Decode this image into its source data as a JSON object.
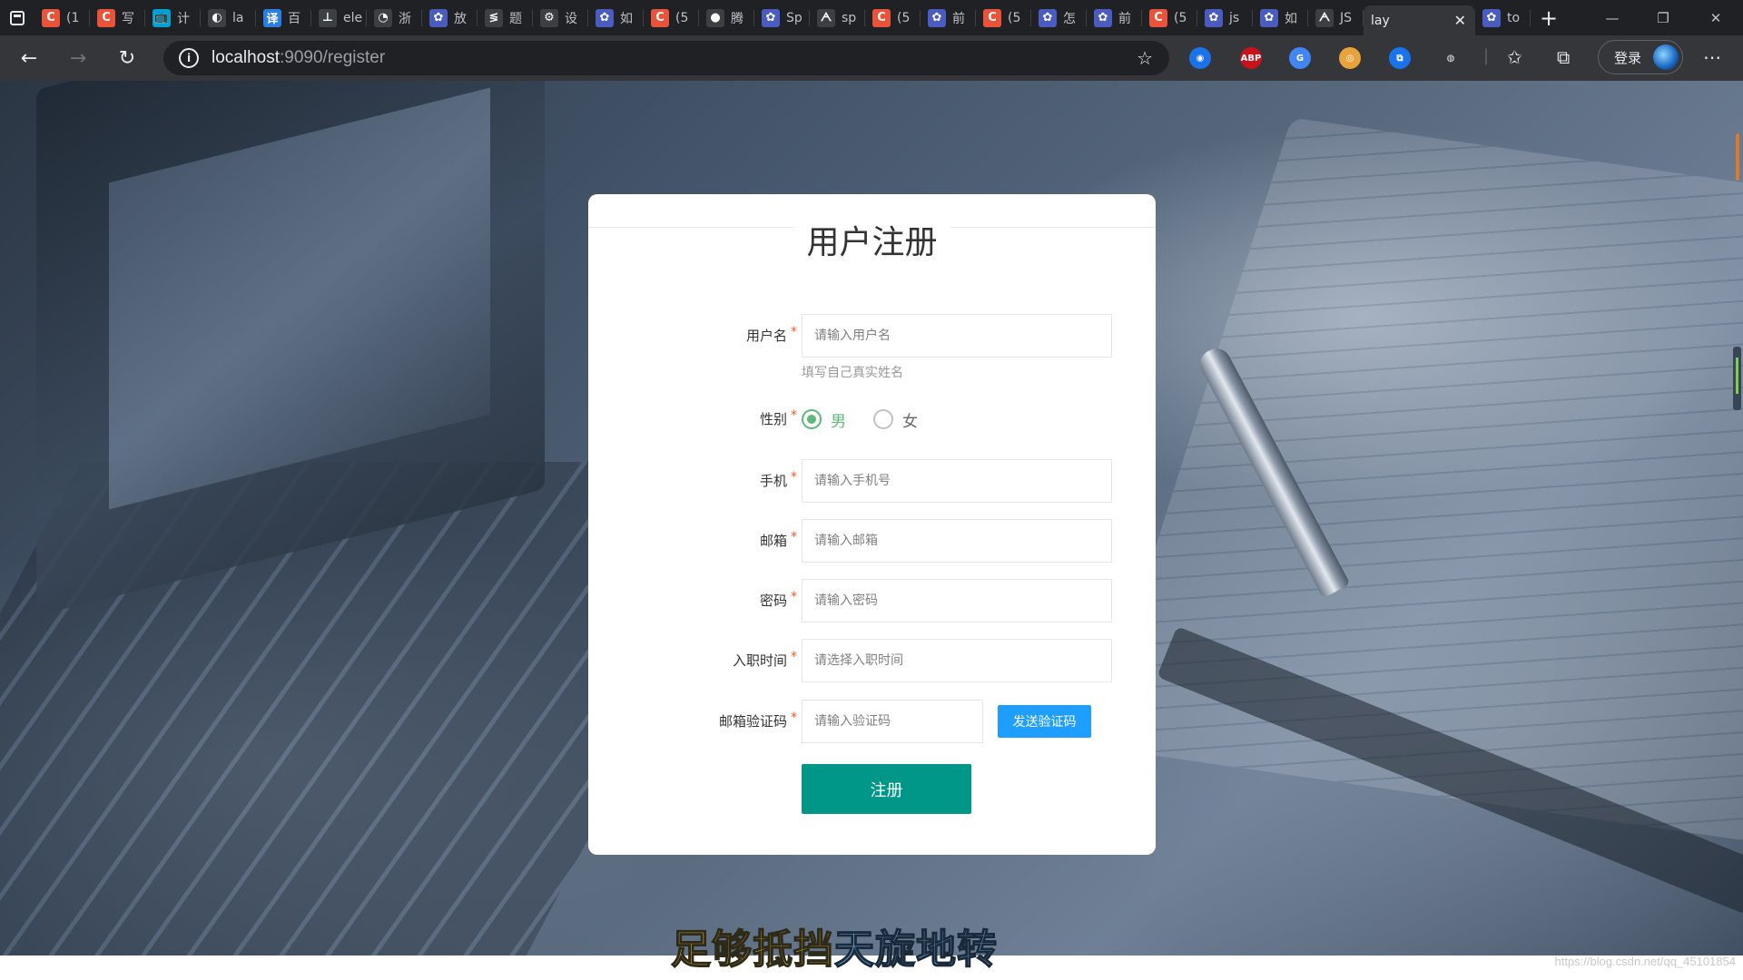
{
  "browser": {
    "tabs": [
      {
        "label": "(1",
        "icon": "csdn-icon",
        "color": "#e9533a",
        "glyph": "C"
      },
      {
        "label": "写",
        "icon": "csdn-icon",
        "color": "#e9533a",
        "glyph": "C"
      },
      {
        "label": "计",
        "icon": "bilibili-icon",
        "color": "#00a1d6",
        "glyph": "📺"
      },
      {
        "label": "la",
        "icon": "layui-icon",
        "color": "#3c4043",
        "glyph": "◐"
      },
      {
        "label": "百",
        "icon": "translate-icon",
        "color": "#2a7de1",
        "glyph": "译"
      },
      {
        "label": "ele",
        "icon": "element-icon",
        "color": "#3c4043",
        "glyph": "⊥"
      },
      {
        "label": "浙",
        "icon": "edu-icon",
        "color": "#3c4043",
        "glyph": "◔"
      },
      {
        "label": "放",
        "icon": "baidu-icon",
        "color": "#4a5cbf",
        "glyph": "✿"
      },
      {
        "label": "题",
        "icon": "leetcode-icon",
        "color": "#3c4043",
        "glyph": "≶"
      },
      {
        "label": "设",
        "icon": "gear-icon",
        "color": "#3c4043",
        "glyph": "⚙"
      },
      {
        "label": "如",
        "icon": "baidu-icon",
        "color": "#4a5cbf",
        "glyph": "✿"
      },
      {
        "label": "(5",
        "icon": "csdn-icon",
        "color": "#e9533a",
        "glyph": "C"
      },
      {
        "label": "腾",
        "icon": "tencent-icon",
        "color": "#3c4043",
        "glyph": "●"
      },
      {
        "label": "Sp",
        "icon": "baidu-icon",
        "color": "#4a5cbf",
        "glyph": "✿"
      },
      {
        "label": "sp",
        "icon": "spring-icon",
        "color": "#3c4043",
        "glyph": "ᗅ"
      },
      {
        "label": "(5",
        "icon": "csdn-icon",
        "color": "#e9533a",
        "glyph": "C"
      },
      {
        "label": "前",
        "icon": "baidu-icon",
        "color": "#4a5cbf",
        "glyph": "✿"
      },
      {
        "label": "(5",
        "icon": "csdn-icon",
        "color": "#e9533a",
        "glyph": "C"
      },
      {
        "label": "怎",
        "icon": "baidu-icon",
        "color": "#4a5cbf",
        "glyph": "✿"
      },
      {
        "label": "前",
        "icon": "baidu-icon",
        "color": "#4a5cbf",
        "glyph": "✿"
      },
      {
        "label": "(5",
        "icon": "csdn-icon",
        "color": "#e9533a",
        "glyph": "C"
      },
      {
        "label": "js",
        "icon": "baidu-icon",
        "color": "#4a5cbf",
        "glyph": "✿"
      },
      {
        "label": "如",
        "icon": "baidu-icon",
        "color": "#4a5cbf",
        "glyph": "✿"
      },
      {
        "label": "JS",
        "icon": "spring-icon",
        "color": "#3c4043",
        "glyph": "ᗅ"
      }
    ],
    "active_tab": {
      "label": "lay",
      "close": "✕"
    },
    "last_tab": {
      "label": "to",
      "icon": "baidu-icon",
      "color": "#4a5cbf",
      "glyph": "✿"
    },
    "new_tab": "+",
    "url_host": "localhost",
    "url_path": ":9090/register",
    "login_label": "登录",
    "extensions": [
      {
        "name": "edge-collections-icon",
        "color": "#1a73e8",
        "glyph": "◉"
      },
      {
        "name": "adblock-plus-icon",
        "color": "#c7131b",
        "glyph": "ABP"
      },
      {
        "name": "google-translate-icon",
        "color": "#4285f4",
        "glyph": "G"
      },
      {
        "name": "chrome-icon",
        "color": "#e8a33d",
        "glyph": "◎"
      },
      {
        "name": "screenshot-crop-icon",
        "color": "#1a73e8",
        "glyph": "⧉"
      },
      {
        "name": "page-action-icon",
        "color": "#e8eaed",
        "glyph": "◍"
      }
    ]
  },
  "form": {
    "title": "用户注册",
    "username": {
      "label": "用户名",
      "placeholder": "请输入用户名",
      "hint": "填写自己真实姓名"
    },
    "gender": {
      "label": "性别",
      "options": [
        "男",
        "女"
      ],
      "selected": "男"
    },
    "phone": {
      "label": "手机",
      "placeholder": "请输入手机号"
    },
    "email": {
      "label": "邮箱",
      "placeholder": "请输入邮箱"
    },
    "password": {
      "label": "密码",
      "placeholder": "请输入密码"
    },
    "hire_date": {
      "label": "入职时间",
      "placeholder": "请选择入职时间"
    },
    "email_code": {
      "label": "邮箱验证码",
      "placeholder": "请输入验证码",
      "send_label": "发送验证码"
    },
    "required_mark": "*",
    "submit_label": "注册"
  },
  "overlay": {
    "subtitle_a": "足够抵挡",
    "subtitle_b": "天旋地转",
    "watermark": "https://blog.csdn.net/qq_45101854"
  },
  "colors": {
    "submit": "#009688",
    "send_code": "#1E9FFF",
    "radio_checked": "#5FB878",
    "required": "#ff5722"
  }
}
